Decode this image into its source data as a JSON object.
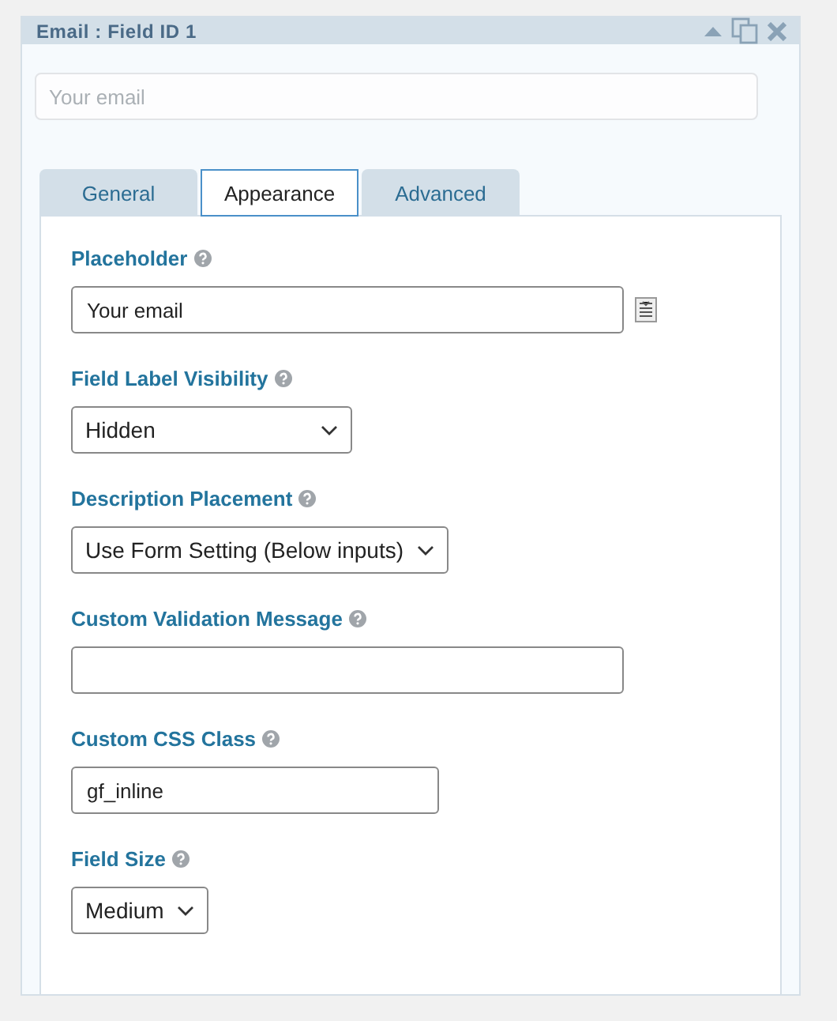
{
  "header": {
    "title": "Email : Field ID 1"
  },
  "preview": {
    "placeholder": "Your email"
  },
  "tabs": [
    {
      "label": "General",
      "selected": false
    },
    {
      "label": "Appearance",
      "selected": true
    },
    {
      "label": "Advanced",
      "selected": false
    }
  ],
  "settings": [
    {
      "kind": "text",
      "label": "Placeholder",
      "value": "Your email",
      "merge_tags": true
    },
    {
      "kind": "select",
      "label": "Field Label Visibility",
      "value": "Hidden",
      "merge_tags": false
    },
    {
      "kind": "select",
      "label": "Description Placement",
      "value": "Use Form Setting (Below inputs)",
      "merge_tags": false
    },
    {
      "kind": "text",
      "label": "Custom Validation Message",
      "merge_tags": false
    },
    {
      "kind": "text",
      "label": "Custom CSS Class",
      "value": "gf_inline",
      "merge_tags": false
    },
    {
      "kind": "select",
      "label": "Field Size",
      "value": "Medium",
      "merge_tags": false
    }
  ]
}
